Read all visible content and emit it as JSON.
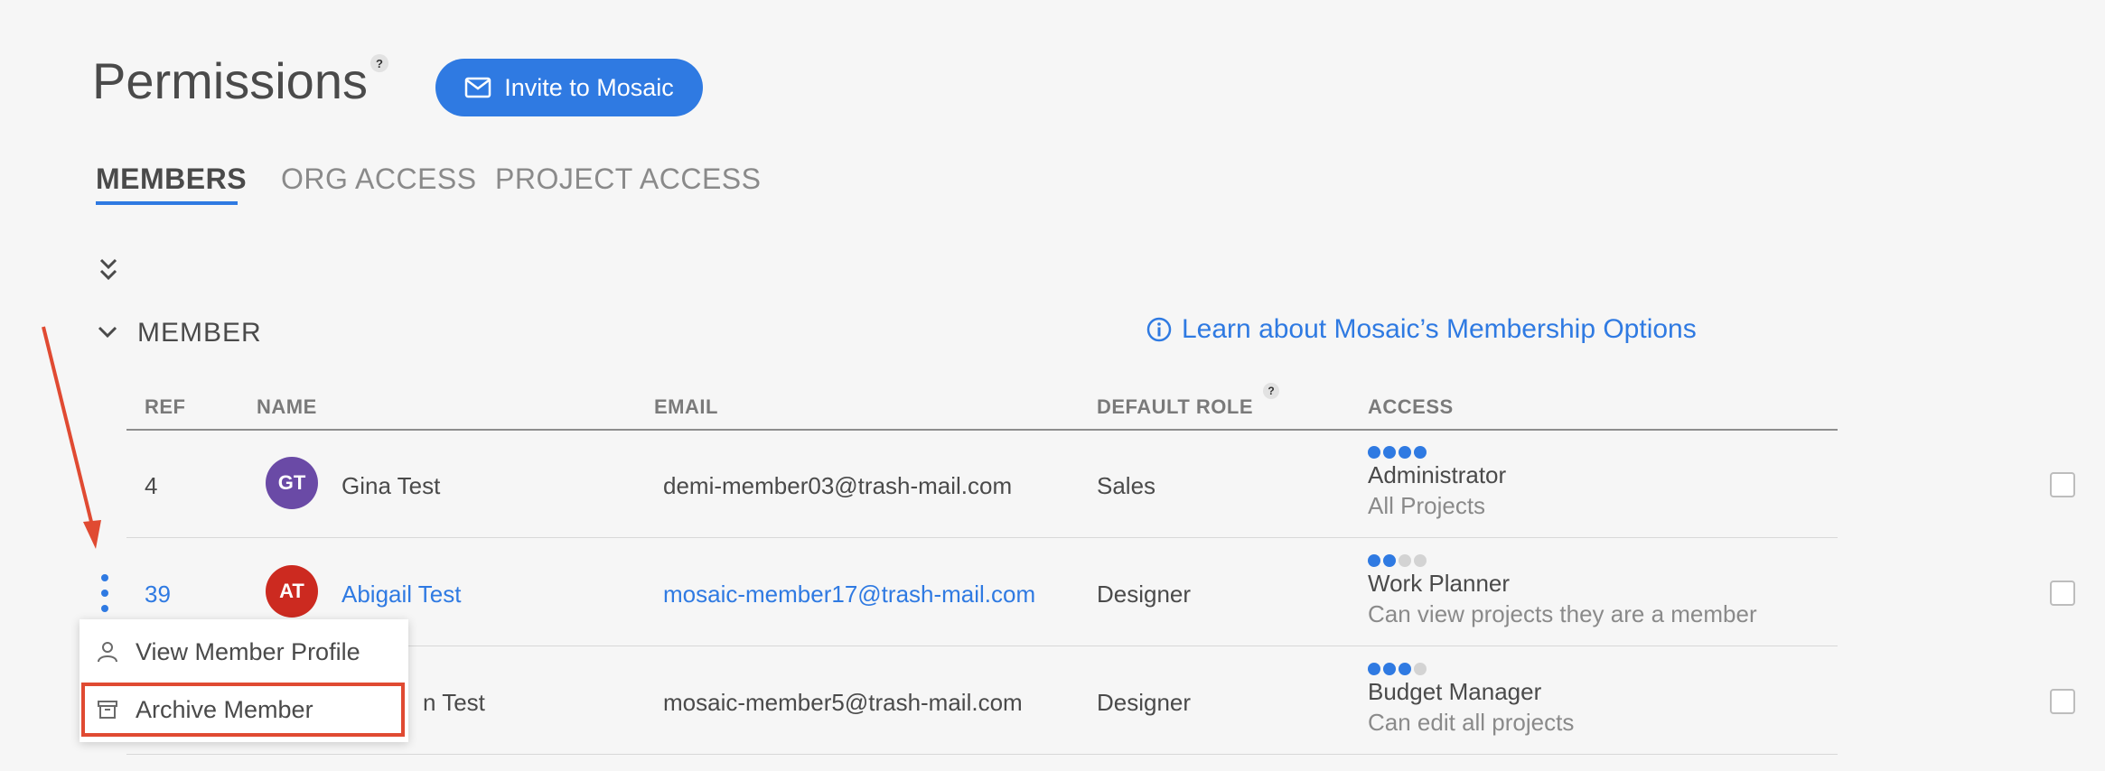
{
  "header": {
    "title": "Permissions",
    "help": "?",
    "invite_label": "Invite to Mosaic"
  },
  "tabs": [
    {
      "label": "MEMBERS",
      "active": true
    },
    {
      "label": "ORG ACCESS",
      "active": false
    },
    {
      "label": "PROJECT ACCESS",
      "active": false
    }
  ],
  "section": {
    "label": "MEMBER",
    "learn_link": "Learn about Mosaic’s Membership Options"
  },
  "table": {
    "headers": {
      "ref": "REF",
      "name": "NAME",
      "email": "EMAIL",
      "role": "DEFAULT ROLE",
      "role_help": "?",
      "access": "ACCESS"
    },
    "rows": [
      {
        "ref": "4",
        "initials": "GT",
        "avatar_color": "#6a4aa6",
        "name": "Gina Test",
        "email": "demi-member03@trash-mail.com",
        "role": "Sales",
        "access_level": 4,
        "access_title": "Administrator",
        "access_sub": "All Projects",
        "highlighted": false
      },
      {
        "ref": "39",
        "initials": "AT",
        "avatar_color": "#cc2a20",
        "name": "Abigail Test",
        "email": "mosaic-member17@trash-mail.com",
        "role": "Designer",
        "access_level": 2,
        "access_title": "Work Planner",
        "access_sub": "Can view projects they are a member",
        "highlighted": true
      },
      {
        "ref": "",
        "initials": "",
        "avatar_color": "",
        "name": "n Test",
        "email": "mosaic-member5@trash-mail.com",
        "role": "Designer",
        "access_level": 3,
        "access_title": "Budget Manager",
        "access_sub": "Can edit all projects",
        "highlighted": false
      }
    ]
  },
  "context_menu": {
    "items": [
      {
        "label": "View Member Profile",
        "icon": "person-icon"
      },
      {
        "label": "Archive Member",
        "icon": "archive-icon"
      }
    ]
  },
  "colors": {
    "accent": "#2f7ae2",
    "annotation": "#e04a32"
  }
}
